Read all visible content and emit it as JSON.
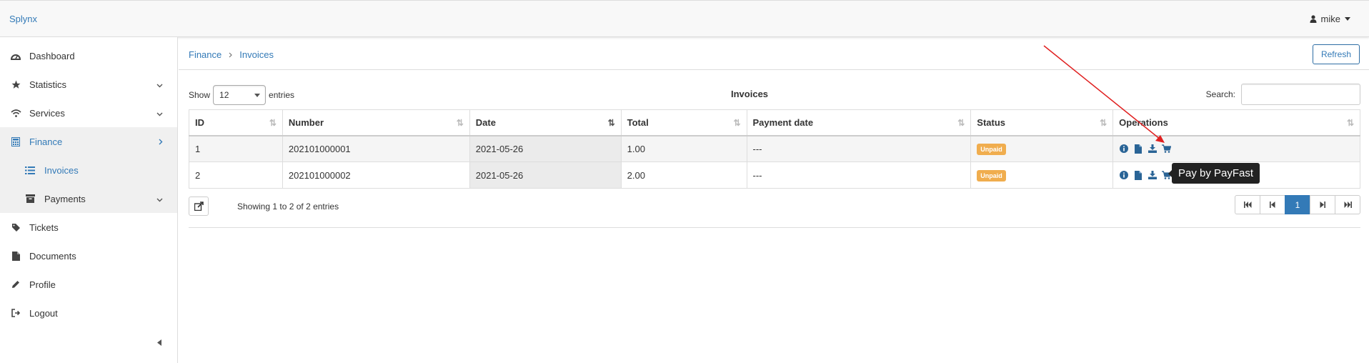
{
  "app": {
    "brand": "Splynx",
    "user": "mike"
  },
  "sidebar": {
    "items": [
      {
        "label": "Dashboard",
        "icon": "dashboard-icon"
      },
      {
        "label": "Statistics",
        "icon": "star-icon"
      },
      {
        "label": "Services",
        "icon": "wifi-icon"
      },
      {
        "label": "Finance",
        "icon": "calculator-icon"
      },
      {
        "label": "Invoices",
        "icon": "list-icon"
      },
      {
        "label": "Payments",
        "icon": "archive-icon"
      },
      {
        "label": "Tickets",
        "icon": "tag-icon"
      },
      {
        "label": "Documents",
        "icon": "file-icon"
      },
      {
        "label": "Profile",
        "icon": "pencil-icon"
      },
      {
        "label": "Logout",
        "icon": "logout-icon"
      }
    ]
  },
  "breadcrumb": {
    "parent": "Finance",
    "current": "Invoices"
  },
  "toolbar": {
    "refresh_label": "Refresh"
  },
  "table_controls": {
    "show_label": "Show",
    "entries_value": "12",
    "entries_label": "entries",
    "title": "Invoices",
    "search_label": "Search:"
  },
  "table": {
    "columns": [
      "ID",
      "Number",
      "Date",
      "Total",
      "Payment date",
      "Status",
      "Operations"
    ],
    "rows": [
      {
        "id": "1",
        "number": "202101000001",
        "date": "2021-05-26",
        "total": "1.00",
        "payment_date": "---",
        "status": "Unpaid"
      },
      {
        "id": "2",
        "number": "202101000002",
        "date": "2021-05-26",
        "total": "2.00",
        "payment_date": "---",
        "status": "Unpaid"
      }
    ]
  },
  "tooltip": {
    "text": "Pay by PayFast"
  },
  "footer": {
    "info": "Showing 1 to 2 of 2 entries",
    "current_page": "1"
  },
  "colors": {
    "link": "#337ab7",
    "badge_unpaid": "#f0ad4e",
    "annotation_arrow": "#e02020"
  }
}
